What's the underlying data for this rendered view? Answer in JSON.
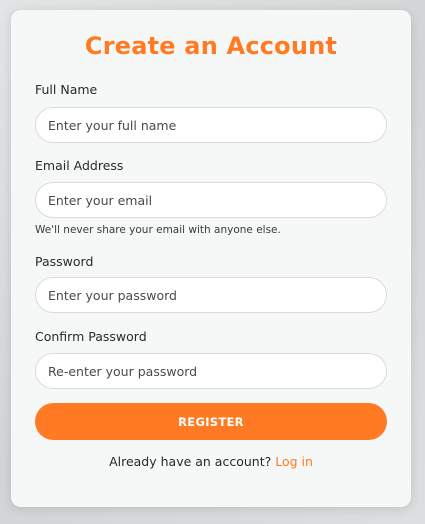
{
  "form": {
    "title": "Create an Account",
    "full_name": {
      "label": "Full Name",
      "placeholder": "Enter your full name",
      "value": ""
    },
    "email": {
      "label": "Email Address",
      "placeholder": "Enter your email",
      "value": "",
      "help": "We'll never share your email with anyone else."
    },
    "password": {
      "label": "Password",
      "placeholder": "Enter your password",
      "value": ""
    },
    "confirm_password": {
      "label": "Confirm Password",
      "placeholder": "Re-enter your password",
      "value": ""
    },
    "register_label": "REGISTER",
    "login_prompt": "Already have an account?",
    "login_link": "Log in"
  },
  "colors": {
    "accent": "#ff7a22",
    "card": "#f6f7f7",
    "background": "#d6d8da"
  }
}
